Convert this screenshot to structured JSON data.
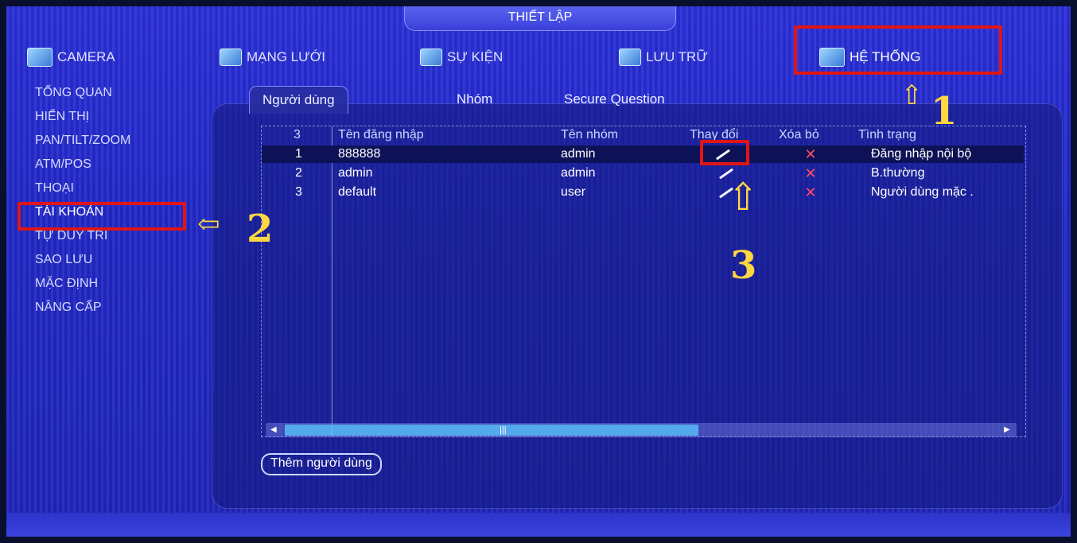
{
  "title": "THIẾT LẬP",
  "top_nav": [
    {
      "label": "CAMERA",
      "icon": "camera-icon"
    },
    {
      "label": "MẠNG LƯỚI",
      "icon": "network-icon"
    },
    {
      "label": "SỰ KIỆN",
      "icon": "event-icon"
    },
    {
      "label": "LƯU TRỮ",
      "icon": "storage-icon"
    },
    {
      "label": "HỆ THỐNG",
      "icon": "system-icon",
      "selected": true
    }
  ],
  "sidebar": {
    "items": [
      {
        "label": "TỔNG QUAN"
      },
      {
        "label": "HIỂN THỊ"
      },
      {
        "label": "PAN/TILT/ZOOM"
      },
      {
        "label": "ATM/POS"
      },
      {
        "label": "THOẠI"
      },
      {
        "label": "TÀI KHOẢN",
        "active": true
      },
      {
        "label": "TỰ DUY TRÌ"
      },
      {
        "label": "SAO LƯU"
      },
      {
        "label": "MẶC ĐỊNH"
      },
      {
        "label": "NÂNG CẤP"
      }
    ]
  },
  "tabs": [
    {
      "label": "Người dùng",
      "active": true
    },
    {
      "label": "Nhóm"
    },
    {
      "label": "Secure Question"
    }
  ],
  "table": {
    "headers": {
      "count": "3",
      "username": "Tên đăng nhập",
      "group": "Tên nhóm",
      "modify": "Thay đổi",
      "delete": "Xóa bỏ",
      "status": "Tình trạng"
    },
    "rows": [
      {
        "index": "1",
        "username": "888888",
        "group": "admin",
        "status": "Đăng nhập nội bộ",
        "selected": true
      },
      {
        "index": "2",
        "username": "admin",
        "group": "admin",
        "status": "B.thường"
      },
      {
        "index": "3",
        "username": "default",
        "group": "user",
        "status": "Người dùng mặc ."
      }
    ]
  },
  "add_user_button": "Thêm người dùng",
  "annotations": {
    "step1": "1",
    "step2": "2",
    "step3": "3",
    "highlight_color": "#e01515",
    "arrow_color": "#ffd740"
  }
}
